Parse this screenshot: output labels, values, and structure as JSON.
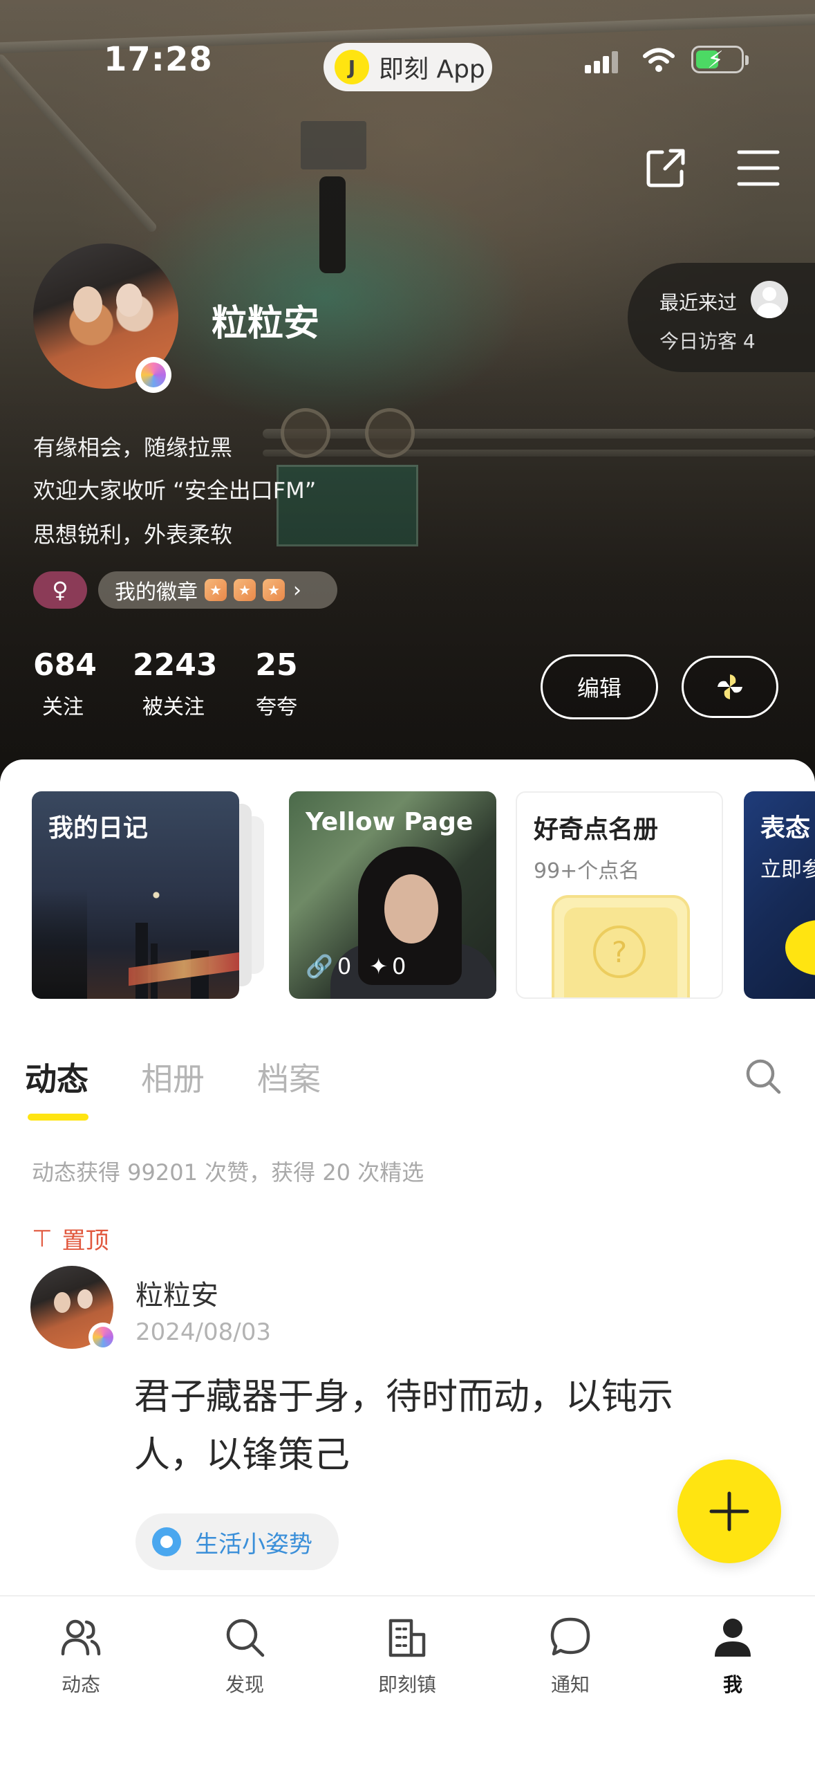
{
  "status_bar": {
    "time": "17:28",
    "app_pill_label": "即刻 App",
    "app_pill_logo": "J"
  },
  "profile": {
    "nickname": "粒粒安",
    "bio": [
      "有缘相会，随缘拉黑",
      "欢迎大家收听 “安全出口FM”",
      "思想锐利，外表柔软"
    ],
    "gender_symbol": "♀",
    "badges_label": "我的徽章",
    "visitors": {
      "recent_label": "最近来过",
      "today_label": "今日访客 4"
    },
    "stats": [
      {
        "value": "684",
        "label": "关注"
      },
      {
        "value": "2243",
        "label": "被关注"
      },
      {
        "value": "25",
        "label": "夸夸"
      }
    ],
    "edit_label": "编辑"
  },
  "cards": {
    "diary": {
      "title": "我的日记"
    },
    "yellow_page": {
      "title": "Yellow Page",
      "links": "0",
      "stars": "0"
    },
    "curiosity": {
      "title": "好奇点名册",
      "subtitle": "99+个点名"
    },
    "biaotai": {
      "title": "表态",
      "subtitle": "立即参"
    }
  },
  "tabs": [
    {
      "label": "动态",
      "active": true
    },
    {
      "label": "相册",
      "active": false
    },
    {
      "label": "档案",
      "active": false
    }
  ],
  "feed": {
    "summary": "动态获得 99201 次赞，获得 20 次精选",
    "pinned_label": "置顶",
    "post": {
      "author": "粒粒安",
      "date": "2024/08/03",
      "text": "君子藏器于身，待时而动，以钝示人，以锋策己",
      "topic": "生活小姿势"
    }
  },
  "bottom_nav": [
    {
      "label": "动态",
      "icon": "people-icon"
    },
    {
      "label": "发现",
      "icon": "search-icon"
    },
    {
      "label": "即刻镇",
      "icon": "town-icon"
    },
    {
      "label": "通知",
      "icon": "chat-bubble-icon"
    },
    {
      "label": "我",
      "icon": "person-icon",
      "active": true
    }
  ],
  "colors": {
    "accent_yellow": "#ffe411",
    "pinned_red": "#e1583e",
    "topic_blue": "#3a8fd9",
    "gender_tag": "#8b3b57"
  }
}
